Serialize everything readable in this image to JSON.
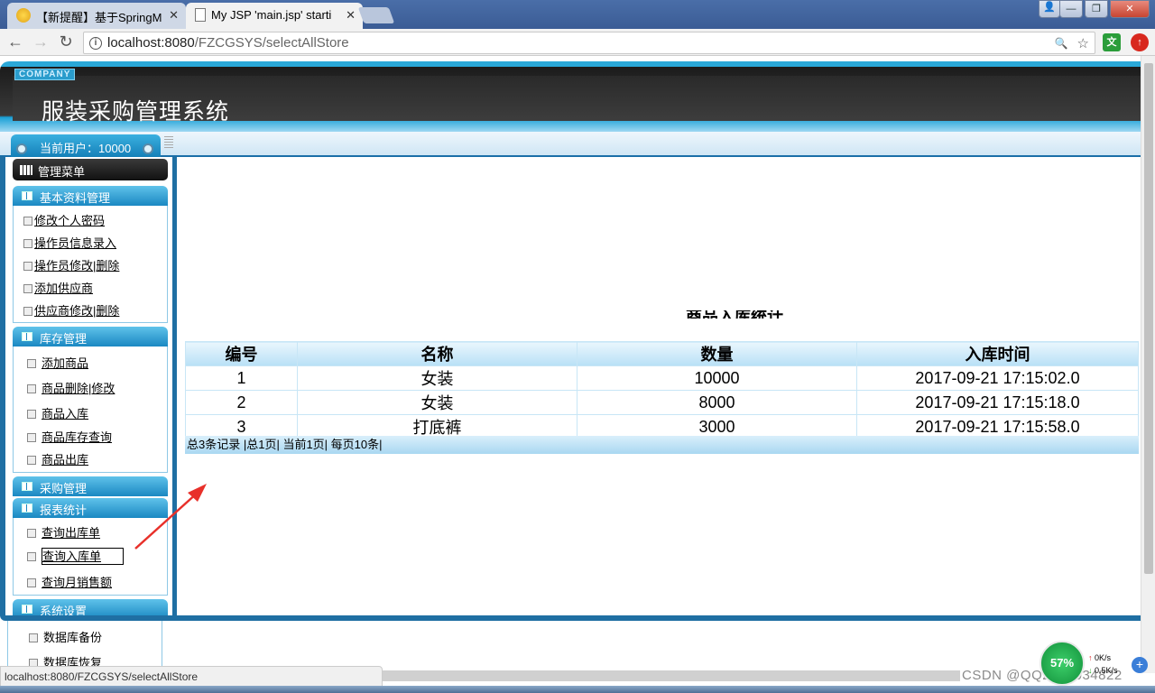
{
  "browser": {
    "tabs": [
      {
        "label": "【新提醒】基于SpringM",
        "close": "✕"
      },
      {
        "label": "My JSP 'main.jsp' starti",
        "close": "✕"
      }
    ],
    "window_buttons": {
      "user": "👤",
      "minimize": "—",
      "maximize": "❐",
      "close": "✕"
    },
    "nav": {
      "back": "←",
      "forward": "→",
      "reload": "↻"
    },
    "url_host": "localhost:8080",
    "url_path": "/FZCGSYS/selectAllStore",
    "info_icon": "i",
    "zoom_icon": "🔍",
    "star_icon": "☆",
    "ext1": "文",
    "ext2": "↑",
    "status_url": "localhost:8080/FZCGSYS/selectAllStore"
  },
  "header": {
    "company": "COMPANY",
    "title": "服装采购管理系统",
    "current_user": "当前用户：10000"
  },
  "menu": {
    "title": "管理菜单",
    "sections": {
      "basic": {
        "label": "基本资料管理",
        "items": [
          "修改个人密码",
          "操作员信息录入",
          "操作员修改|删除",
          "添加供应商",
          "供应商修改|删除"
        ]
      },
      "stock": {
        "label": "库存管理",
        "items": [
          "添加商品",
          "商品删除|修改",
          "商品入库",
          "商品库存查询",
          "商品出库"
        ]
      },
      "purchase": {
        "label": "采购管理"
      },
      "report": {
        "label": "报表统计",
        "items": [
          "查询出库单",
          "查询入库单",
          "查询月销售额"
        ]
      },
      "system": {
        "label": "系统设置",
        "items": [
          "数据库备份",
          "数据库恢复"
        ]
      }
    }
  },
  "content": {
    "heading": "商品入库统计",
    "columns": [
      "编号",
      "名称",
      "数量",
      "入库时间"
    ],
    "rows": [
      [
        "1",
        "女装",
        "10000",
        "2017-09-21 17:15:02.0"
      ],
      [
        "2",
        "女装",
        "8000",
        "2017-09-21 17:15:18.0"
      ],
      [
        "3",
        "打底裤",
        "3000",
        "2017-09-21 17:15:58.0"
      ]
    ],
    "pagination": "总3条记录 |总1页| 当前1页| 每页10条|"
  },
  "tray": {
    "gauge": "57%",
    "up": "0K/s",
    "down": "0.5K/s",
    "plus": "+"
  },
  "watermark": "CSDN @QQ2892034822",
  "colors": {
    "accent": "#1f6fa3",
    "arrow": "#e8302a"
  }
}
